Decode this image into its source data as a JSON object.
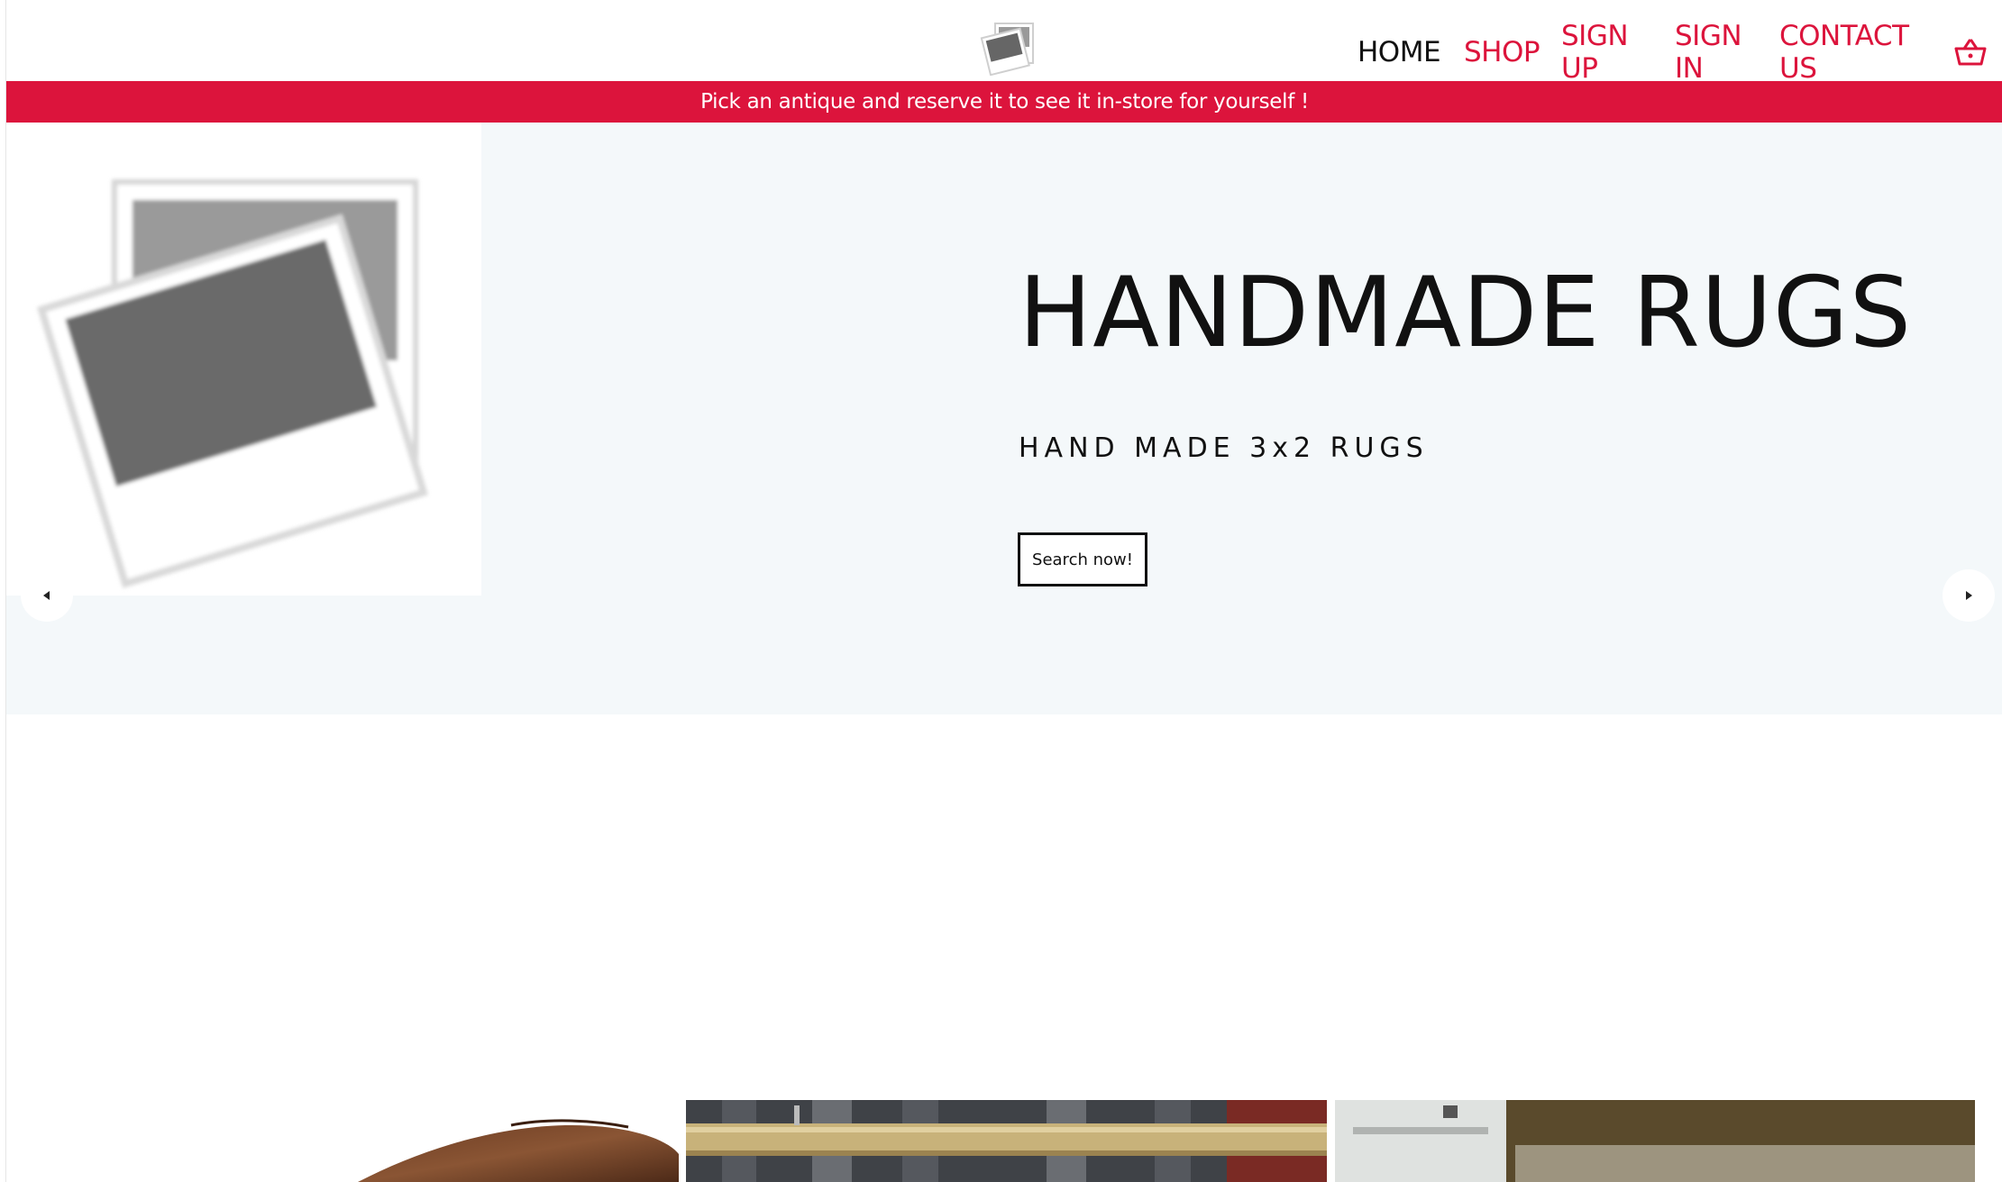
{
  "header": {
    "logo_icon": "photo-placeholder-icon",
    "nav": {
      "home": "HOME",
      "shop": "SHOP",
      "sign_up": "SIGN UP",
      "sign_in": "SIGN IN",
      "contact_us": "CONTACT US"
    },
    "cart_icon": "basket-icon"
  },
  "promo": {
    "text": "Pick an antique and reserve it to see it in-store for yourself !"
  },
  "hero": {
    "image_icon": "photo-placeholder-icon",
    "title": "HANDMADE RUGS",
    "subtitle": "HAND MADE 3x2 RUGS",
    "button_label": "Search now!",
    "prev_icon": "caret-left-icon",
    "next_icon": "caret-right-icon"
  },
  "products": [
    {
      "image": "wooden-furniture-photo"
    },
    {
      "image": "wooden-rod-photo"
    },
    {
      "image": "display-case-photo"
    }
  ],
  "colors": {
    "accent": "#dc143c",
    "hero_background": "#f4f8fa",
    "text": "#111111"
  }
}
